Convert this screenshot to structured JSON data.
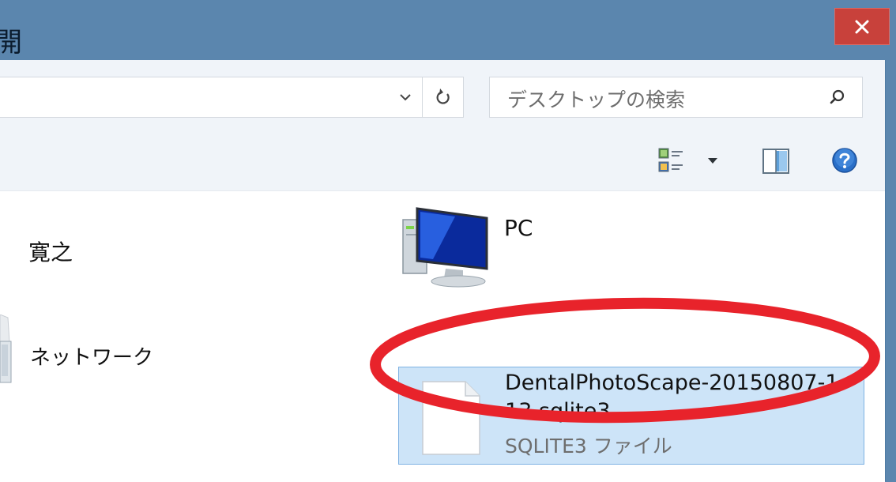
{
  "window": {
    "title": "開く",
    "close_icon": "close-x-icon"
  },
  "address_bar": {
    "value": "",
    "dropdown_icon": "chevron-down-icon",
    "refresh_icon": "refresh-icon"
  },
  "search": {
    "placeholder": "デスクトップの検索",
    "icon": "search-icon"
  },
  "toolbar": {
    "view_icon": "change-view-icon",
    "view_dropdown_icon": "triangle-down-icon",
    "preview_icon": "preview-pane-icon",
    "help_icon": "help-icon"
  },
  "items": {
    "user": {
      "label": "寛之",
      "icon": "user-folder-icon"
    },
    "network": {
      "label": "ネットワーク",
      "icon": "network-icon"
    },
    "pc": {
      "label": "PC",
      "icon": "computer-monitor-icon"
    },
    "file": {
      "name_line1": "DentalPhotoScape-20150807-1",
      "name_line2": "13.sqlite3",
      "type": "SQLITE3 ファイル",
      "icon": "blank-document-icon",
      "selected": true
    }
  },
  "colors": {
    "titlebar": "#5b86ae",
    "close_button": "#c8413b",
    "selection_fill": "#cde4f8",
    "selection_border": "#7fb2e3",
    "annotation_circle": "#e8232b",
    "help_icon": "#2a6fc8"
  }
}
